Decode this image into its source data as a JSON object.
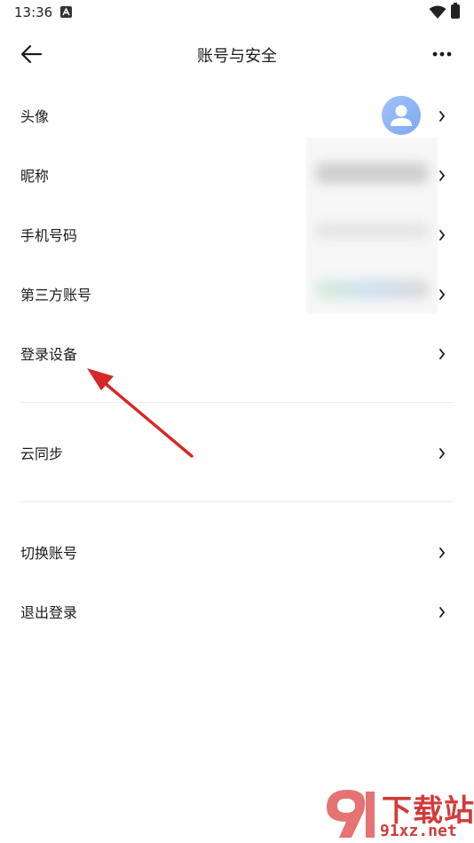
{
  "status_bar": {
    "time": "13:36"
  },
  "header": {
    "title": "账号与安全"
  },
  "menu": {
    "items": [
      {
        "label": "头像"
      },
      {
        "label": "昵称"
      },
      {
        "label": "手机号码"
      },
      {
        "label": "第三方账号"
      },
      {
        "label": "登录设备"
      },
      {
        "label": "云同步"
      },
      {
        "label": "切换账号"
      },
      {
        "label": "退出登录"
      }
    ]
  },
  "watermark": {
    "brand": "下载站",
    "domain": "91xz.net"
  },
  "colors": {
    "accent_avatar": "#8bb3f4",
    "annotation_arrow": "#d62828",
    "watermark": "#d23b3b"
  },
  "icons": {
    "back": "arrow-left-icon",
    "more": "more-horizontal-icon",
    "chevron": "chevron-right-icon",
    "wifi": "wifi-icon",
    "battery": "battery-icon",
    "avatar": "user-icon"
  }
}
